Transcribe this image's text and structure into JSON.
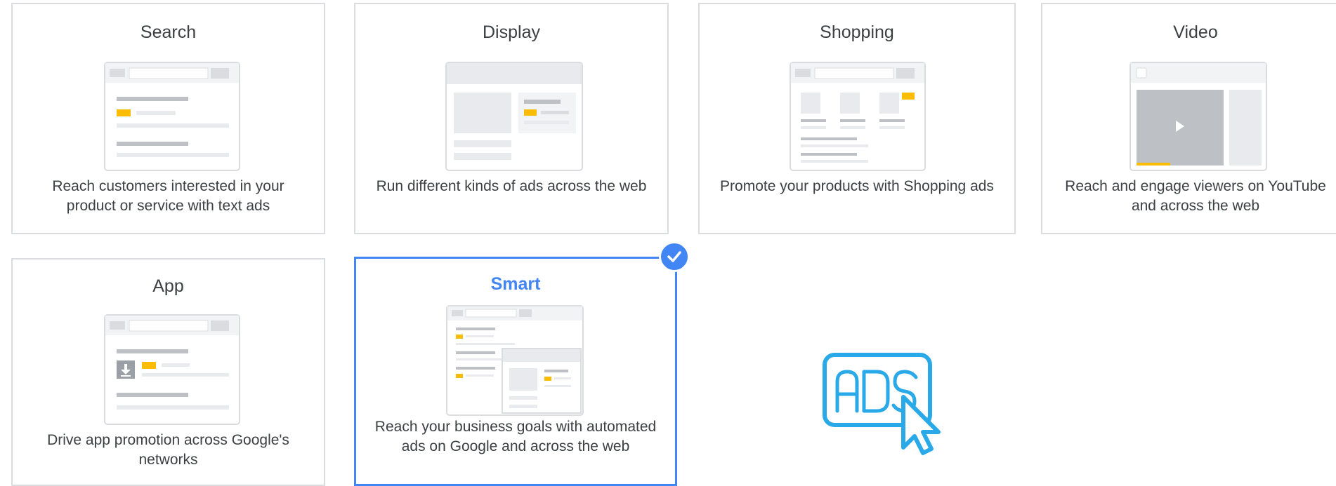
{
  "campaign_types": [
    {
      "title": "Search",
      "description": "Reach customers interested in your product or service with text ads",
      "illustration": "search-results-page"
    },
    {
      "title": "Display",
      "description": "Run different kinds of ads across the web",
      "illustration": "display-webpage"
    },
    {
      "title": "Shopping",
      "description": "Promote your products with Shopping ads",
      "illustration": "shopping-product-grid"
    },
    {
      "title": "Video",
      "description": "Reach and engage viewers on YouTube and across the web",
      "illustration": "video-player"
    },
    {
      "title": "App",
      "description": "Drive app promotion across Google's networks",
      "illustration": "app-download"
    },
    {
      "title": "Smart",
      "description": "Reach your business goals with automated ads on Google and across the web",
      "illustration": "search-plus-display",
      "selected": true
    }
  ],
  "selected_indicator_icon": "checkmark-icon",
  "decoration": {
    "logo_text": "ADS",
    "logo_icon": "cursor-pointer-icon",
    "accent_color": "#29a9e8"
  },
  "colors": {
    "selected_border": "#4285f4",
    "card_border": "#dadce0",
    "ad_highlight": "#fbbc04"
  }
}
